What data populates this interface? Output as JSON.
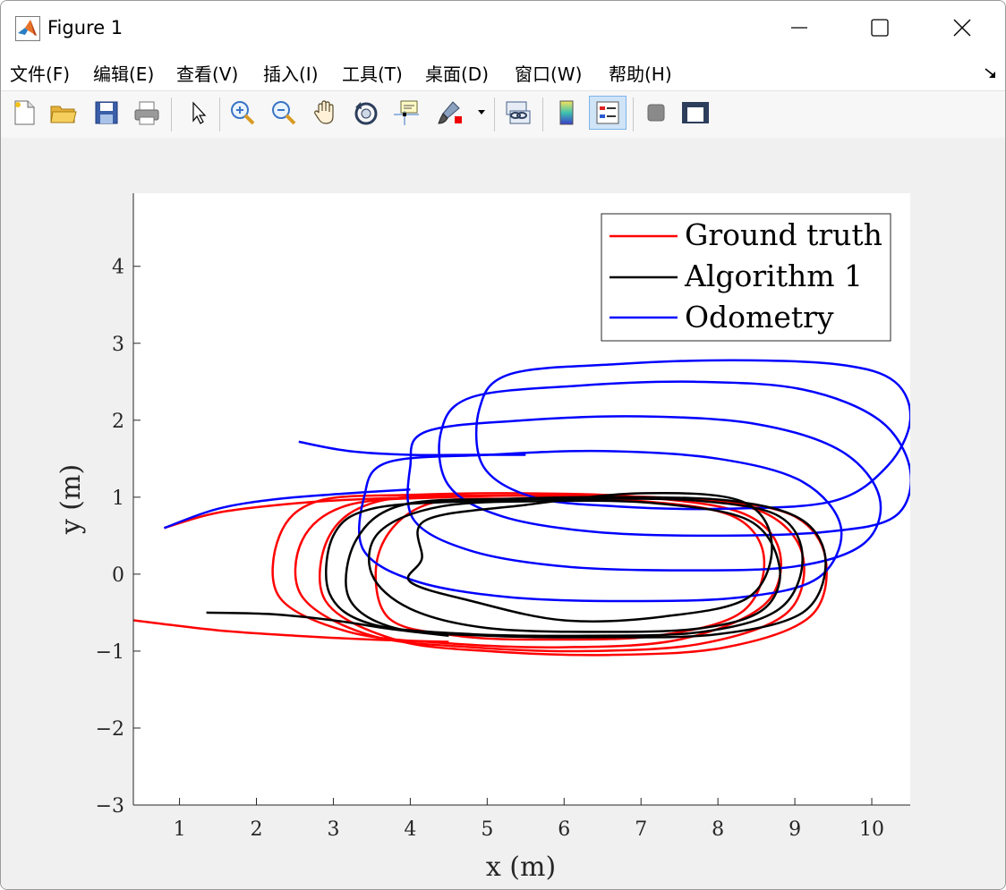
{
  "window": {
    "title": "Figure 1"
  },
  "menu": [
    {
      "label": "文件(F)"
    },
    {
      "label": "编辑(E)"
    },
    {
      "label": "查看(V)"
    },
    {
      "label": "插入(I)"
    },
    {
      "label": "工具(T)"
    },
    {
      "label": "桌面(D)"
    },
    {
      "label": "窗口(W)"
    },
    {
      "label": "帮助(H)"
    }
  ],
  "toolbar": {
    "buttons": [
      "new-figure-icon",
      "open-file-icon",
      "save-icon",
      "print-icon",
      "edit-plot-arrow-icon",
      "zoom-in-icon",
      "zoom-out-icon",
      "pan-hand-icon",
      "rotate-3d-icon",
      "data-cursor-icon",
      "brush-icon",
      "link-plot-icon",
      "colorbar-icon",
      "legend-icon",
      "hide-plot-tools-icon",
      "show-plot-tools-icon"
    ]
  },
  "chart_data": {
    "type": "line",
    "xlabel": "x (m)",
    "ylabel": "y (m)",
    "xlim": [
      0.4,
      10.5
    ],
    "ylim": [
      -3,
      4.95
    ],
    "xticks": [
      "1",
      "2",
      "3",
      "4",
      "5",
      "6",
      "7",
      "8",
      "9",
      "10"
    ],
    "yticks": [
      "4",
      "3",
      "2",
      "1",
      "0",
      "−1",
      "−2",
      "−3"
    ],
    "legend_position": "top-right",
    "series": [
      {
        "name": "Ground truth",
        "color": "#ff0000",
        "loops": [
          {
            "x": [
              2.8,
              4.0,
              5.5,
              7.0,
              8.3,
              8.8,
              8.6,
              7.5,
              6.0,
              4.5,
              3.2,
              2.3,
              2.3,
              2.8
            ],
            "y": [
              0.95,
              1.03,
              1.05,
              1.0,
              0.8,
              0.3,
              -0.4,
              -0.85,
              -0.95,
              -0.9,
              -0.75,
              -0.3,
              0.5,
              0.95
            ]
          },
          {
            "x": [
              3.2,
              4.5,
              6.0,
              7.5,
              8.6,
              9.1,
              8.9,
              7.8,
              6.3,
              4.8,
              3.5,
              2.6,
              2.6,
              3.2
            ],
            "y": [
              0.9,
              1.0,
              1.02,
              0.98,
              0.8,
              0.25,
              -0.5,
              -0.9,
              -1.0,
              -0.95,
              -0.8,
              -0.3,
              0.45,
              0.9
            ]
          },
          {
            "x": [
              3.6,
              5.0,
              6.5,
              8.0,
              9.0,
              9.4,
              9.2,
              8.1,
              6.6,
              5.0,
              3.8,
              2.9,
              2.95,
              3.6
            ],
            "y": [
              0.95,
              1.02,
              1.0,
              0.95,
              0.75,
              0.2,
              -0.55,
              -0.95,
              -1.05,
              -1.0,
              -0.85,
              -0.35,
              0.5,
              0.95
            ]
          },
          {
            "x": [
              4.2,
              5.5,
              7.0,
              8.2,
              8.6,
              8.3,
              7.2,
              5.8,
              4.6,
              3.7,
              3.6,
              4.2
            ],
            "y": [
              0.9,
              0.98,
              0.95,
              0.75,
              0.2,
              -0.5,
              -0.8,
              -0.85,
              -0.8,
              -0.55,
              0.3,
              0.9
            ]
          }
        ],
        "tails": [
          {
            "x": [
              0.8,
              1.5,
              2.5,
              3.5,
              4.5
            ],
            "y": [
              0.6,
              0.8,
              0.92,
              0.98,
              1.0
            ]
          },
          {
            "x": [
              0.4,
              1.5,
              2.5,
              3.5,
              4.5
            ],
            "y": [
              -0.6,
              -0.73,
              -0.8,
              -0.85,
              -0.88
            ]
          }
        ]
      },
      {
        "name": "Algorithm 1",
        "color": "#000000",
        "loops": [
          {
            "x": [
              3.5,
              4.8,
              6.3,
              7.8,
              8.8,
              9.1,
              8.8,
              7.8,
              6.3,
              4.8,
              3.5,
              2.95,
              3.0,
              3.5
            ],
            "y": [
              0.85,
              0.95,
              0.98,
              0.95,
              0.75,
              0.2,
              -0.45,
              -0.75,
              -0.8,
              -0.78,
              -0.65,
              -0.25,
              0.5,
              0.85
            ]
          },
          {
            "x": [
              3.9,
              5.3,
              6.8,
              8.2,
              9.1,
              9.4,
              9.1,
              8.0,
              6.5,
              5.0,
              3.8,
              3.2,
              3.3,
              3.9
            ],
            "y": [
              0.9,
              0.98,
              1.0,
              0.95,
              0.7,
              0.15,
              -0.5,
              -0.78,
              -0.82,
              -0.8,
              -0.7,
              -0.3,
              0.45,
              0.9
            ]
          },
          {
            "x": [
              4.4,
              5.8,
              7.2,
              8.4,
              8.8,
              8.6,
              7.8,
              6.5,
              5.0,
              4.0,
              3.5,
              3.6,
              4.4
            ],
            "y": [
              0.88,
              0.95,
              0.92,
              0.7,
              0.1,
              -0.45,
              -0.7,
              -0.75,
              -0.7,
              -0.45,
              0.0,
              0.55,
              0.88
            ]
          },
          {
            "x": [
              4.2,
              5.5,
              7.0,
              8.3,
              8.7,
              8.4,
              7.3,
              6.0,
              4.8,
              4.0,
              4.15,
              4.2
            ],
            "y": [
              0.7,
              0.9,
              1.05,
              0.95,
              0.4,
              -0.3,
              -0.55,
              -0.6,
              -0.35,
              -0.1,
              0.2,
              0.7
            ]
          }
        ],
        "tails": [
          {
            "x": [
              1.35,
              2.2,
              3.0,
              3.8,
              4.5
            ],
            "y": [
              -0.5,
              -0.52,
              -0.6,
              -0.72,
              -0.8
            ]
          }
        ]
      },
      {
        "name": "Odometry",
        "color": "#0000ff",
        "loops": [
          {
            "x": [
              3.7,
              5.0,
              6.5,
              8.0,
              9.1,
              9.6,
              9.3,
              8.3,
              6.8,
              5.3,
              4.1,
              3.4,
              3.4,
              3.7
            ],
            "y": [
              1.45,
              1.55,
              1.6,
              1.5,
              1.2,
              0.6,
              -0.05,
              -0.3,
              -0.35,
              -0.3,
              -0.1,
              0.3,
              1.0,
              1.45
            ]
          },
          {
            "x": [
              4.2,
              5.5,
              7.0,
              8.5,
              9.6,
              10.1,
              9.9,
              9.0,
              7.5,
              6.0,
              4.8,
              4.05,
              4.0,
              4.2
            ],
            "y": [
              1.85,
              2.0,
              2.05,
              1.95,
              1.6,
              1.0,
              0.4,
              0.1,
              0.05,
              0.1,
              0.3,
              0.7,
              1.4,
              1.85
            ]
          },
          {
            "x": [
              4.8,
              6.2,
              7.7,
              9.1,
              10.1,
              10.5,
              10.3,
              9.4,
              7.9,
              6.4,
              5.2,
              4.5,
              4.4,
              4.8
            ],
            "y": [
              2.3,
              2.45,
              2.5,
              2.4,
              2.0,
              1.35,
              0.75,
              0.55,
              0.5,
              0.55,
              0.75,
              1.15,
              1.85,
              2.3
            ]
          },
          {
            "x": [
              5.3,
              6.7,
              8.2,
              9.6,
              10.3,
              10.5,
              10.2,
              9.5,
              8.1,
              6.7,
              5.6,
              4.95,
              4.9,
              5.3
            ],
            "y": [
              2.6,
              2.73,
              2.78,
              2.72,
              2.5,
              2.0,
              1.4,
              0.95,
              0.85,
              0.88,
              1.0,
              1.4,
              2.15,
              2.6
            ]
          }
        ],
        "tails": [
          {
            "x": [
              0.8,
              1.5,
              2.3,
              3.2,
              4.0
            ],
            "y": [
              0.6,
              0.85,
              0.98,
              1.05,
              1.1
            ]
          },
          {
            "x": [
              2.55,
              3.2,
              4.0,
              4.8,
              5.5
            ],
            "y": [
              1.72,
              1.6,
              1.55,
              1.55,
              1.55
            ]
          }
        ]
      }
    ]
  }
}
